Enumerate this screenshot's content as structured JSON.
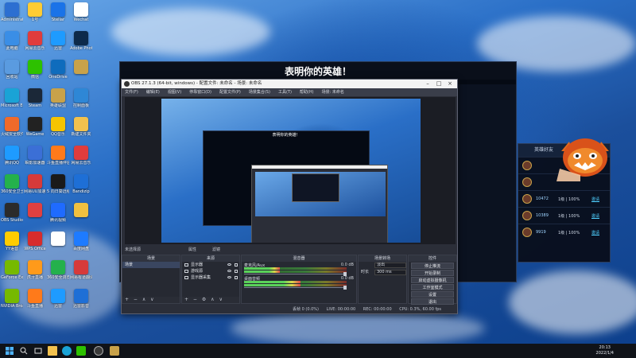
{
  "desktop": {
    "icons": [
      {
        "label": "Administrator",
        "color": "#2c6fd1"
      },
      {
        "label": "1号",
        "color": "#ffcc33"
      },
      {
        "label": "Stellar",
        "color": "#1a73e8"
      },
      {
        "label": "Wechat",
        "color": "#ffffff"
      },
      {
        "label": "此电脑",
        "color": "#3a8ee6"
      },
      {
        "label": "网易云音乐",
        "color": "#e03c3c"
      },
      {
        "label": "迅雷",
        "color": "#1e9bff"
      },
      {
        "label": "Adobe Photoshop",
        "color": "#0d2a4a"
      },
      {
        "label": "回收站",
        "color": "#5a9be0"
      },
      {
        "label": "微信",
        "color": "#2dc100"
      },
      {
        "label": "OneDrive",
        "color": "#0f6cbd"
      },
      {
        "label": "",
        "color": "#c8a24a"
      },
      {
        "label": "Microsoft Edge",
        "color": "#1aa3d6"
      },
      {
        "label": "Steam",
        "color": "#1b2838"
      },
      {
        "label": "英雄联盟",
        "color": "#c8a24a"
      },
      {
        "label": "控制面板",
        "color": "#2e87d6"
      },
      {
        "label": "火绒安全软件",
        "color": "#f06a2a"
      },
      {
        "label": "WeGame",
        "color": "#222222"
      },
      {
        "label": "QQ音乐",
        "color": "#f5c400"
      },
      {
        "label": "新建文件夹",
        "color": "#f2c14e"
      },
      {
        "label": "腾讯QQ",
        "color": "#1e9bff"
      },
      {
        "label": "瞬影加速器",
        "color": "#3b6fd6"
      },
      {
        "label": "斗鱼直播伴侣",
        "color": "#ff7a1a"
      },
      {
        "label": "网易云音乐",
        "color": "#e03c3c"
      },
      {
        "label": "360安全卫士",
        "color": "#24b14c"
      },
      {
        "label": "网易UU加速器",
        "color": "#d63a3a"
      },
      {
        "label": "5 向日葵远程",
        "color": "#1a1a1a"
      },
      {
        "label": "Bandizip",
        "color": "#1e6fd6"
      },
      {
        "label": "OBS Studio",
        "color": "#2b2b2b"
      },
      {
        "label": "",
        "color": "#e04040"
      },
      {
        "label": "腾讯视频",
        "color": "#1f6bff"
      },
      {
        "label": "",
        "color": "#f0c040"
      },
      {
        "label": "YY语音",
        "color": "#ffcc00"
      },
      {
        "label": "WPS Office",
        "color": "#d72c2c"
      },
      {
        "label": "",
        "color": "#ffffff"
      },
      {
        "label": "百度网盘",
        "color": "#1e7bff"
      },
      {
        "label": "GeForce Experience",
        "color": "#76b900"
      },
      {
        "label": "虎牙直播",
        "color": "#ff9a1a"
      },
      {
        "label": "360安全浏览器",
        "color": "#24b14c"
      },
      {
        "label": "网易有道翻译",
        "color": "#d63a3a"
      },
      {
        "label": "NVIDIA Broadcast",
        "color": "#76b900"
      },
      {
        "label": "斗鱼直播",
        "color": "#ff7a1a"
      },
      {
        "label": "迅雷",
        "color": "#1e9bff"
      },
      {
        "label": "迅雷影音",
        "color": "#1e6fd6"
      }
    ]
  },
  "game": {
    "title": "表明你的英雄！"
  },
  "friends": {
    "header": "英雄好友",
    "rows": [
      {
        "name": "",
        "status": "",
        "action": ""
      },
      {
        "name": "",
        "status": "",
        "action": ""
      },
      {
        "name": "10472",
        "status": "1级 | 100%",
        "action": "邀请"
      },
      {
        "name": "10389",
        "status": "1级 | 100%",
        "action": "邀请"
      },
      {
        "name": "9919",
        "status": "1级 | 100%",
        "action": "邀请"
      }
    ]
  },
  "obs": {
    "title": "OBS 27.1.3 (64-bit, windows) - 配置文件: 未命名 - 场景: 未命名",
    "menu": [
      "文件(F)",
      "编辑(E)",
      "视图(V)",
      "停靠窗口(D)",
      "配置文件(P)",
      "场景集合(S)",
      "工具(T)",
      "帮助(H)",
      "场景: 未命名"
    ],
    "preview_game_title": "表明你的英雄！",
    "toolbar_label": "未选择源",
    "toolbar_props": "属性",
    "toolbar_filters": "滤镜",
    "docks": {
      "scenes": "场景",
      "sources": "来源",
      "mixer": "混音器",
      "transitions": "场景转场",
      "controls": "控件"
    },
    "scenes": [
      "场景"
    ],
    "sources": [
      "显示器",
      "游戏源",
      "显示器采集"
    ],
    "mixer": [
      {
        "name": "麦克风/Aux",
        "db": "0.0 dB",
        "level": 0.35
      },
      {
        "name": "桌面音频",
        "db": "0.0 dB",
        "level": 0.55
      }
    ],
    "transition": {
      "type_label": "淡出",
      "duration_label": "时长",
      "duration_value": "300 ms"
    },
    "controls": [
      "停止推流",
      "开始录制",
      "启动虚拟摄像机",
      "工作室模式",
      "设置",
      "退出"
    ],
    "status": {
      "dropped": "丢帧 0 (0.0%)",
      "live": "LIVE: 00:00:00",
      "rec": "REC: 00:00:00",
      "cpu": "CPU: 0.3%, 60.00 fps"
    }
  },
  "taskbar": {
    "time": "20:13",
    "date": "2022/1/4"
  }
}
